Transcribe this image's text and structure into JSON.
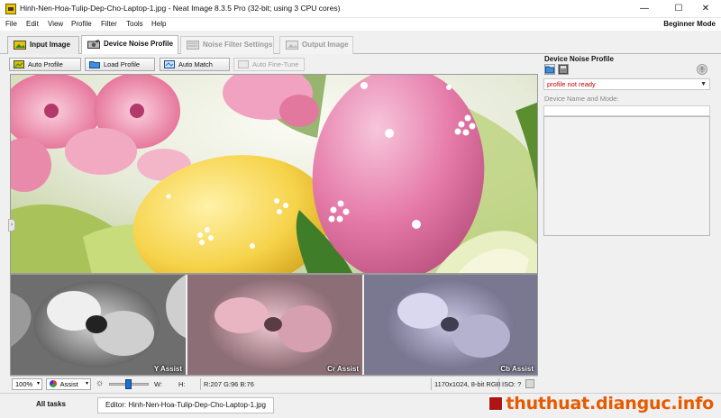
{
  "window": {
    "title": "Hinh-Nen-Hoa-Tulip-Dep-Cho-Laptop-1.jpg - Neat Image 8.3.5 Pro (32-bit; using 3 CPU cores)",
    "minimize": "—",
    "maximize": "☐",
    "close": "✕"
  },
  "menu": {
    "items": [
      "File",
      "Edit",
      "View",
      "Profile",
      "Filter",
      "Tools",
      "Help"
    ],
    "mode": "Beginner Mode"
  },
  "tabs": [
    {
      "label": "Input Image",
      "state": "normal"
    },
    {
      "label": "Device Noise Profile",
      "state": "active"
    },
    {
      "label": "Noise Filter Settings",
      "state": "disabled"
    },
    {
      "label": "Output Image",
      "state": "disabled"
    }
  ],
  "toolbar": {
    "auto_profile": "Auto Profile",
    "load_profile": "Load Profile",
    "auto_match": "Auto Match",
    "auto_fine_tune": "Auto Fine-Tune"
  },
  "thumbnails": [
    {
      "label": "Y Assist"
    },
    {
      "label": "Cr Assist"
    },
    {
      "label": "Cb Assist"
    }
  ],
  "status": {
    "zoom": "100%",
    "assist": "Assist",
    "w_label": "W:",
    "h_label": "H:",
    "rgb": "R:207 G:96  B:76",
    "image_info": "1170x1024, 8-bit RGB",
    "iso": "ISO: ?"
  },
  "bottom_tabs": {
    "all_tasks": "All tasks",
    "editor": "Editor: Hinh-Nen-Hoa-Tulip-Dep-Cho-Laptop-1.jpg"
  },
  "watermark": "thuthuat.dianguc.info",
  "panel": {
    "title": "Device Noise Profile",
    "profile_status": "profile not ready",
    "device_label": "Device Name and Mode:",
    "device_value": ""
  },
  "colors": {
    "accent_blue": "#1e6fd0",
    "status_red": "#c00000",
    "watermark_orange": "#e65a00"
  }
}
